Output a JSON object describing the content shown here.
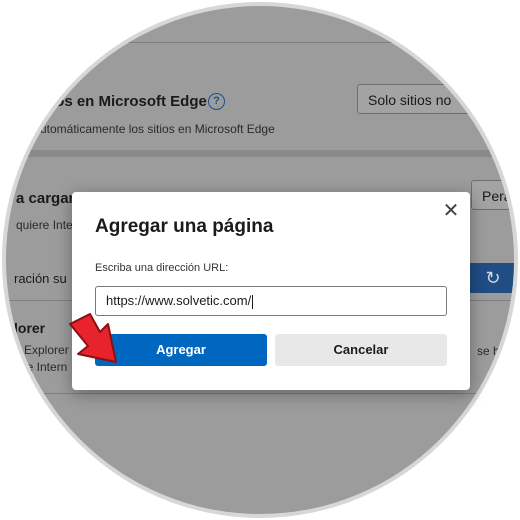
{
  "background": {
    "section1_title": "tios en Microsoft Edge",
    "section1_subtitle": "utomáticamente los sitios en Microsoft Edge",
    "help_icon_glyph": "?",
    "dropdown_label": "Solo sitios no",
    "section2_title": "a cargar",
    "section2_subtitle": "quiere Inter",
    "section2_button_label": "Pera",
    "section3_label": "ración su",
    "section4_title": "lorer",
    "section4_line1": "Explorer",
    "section4_line2": "le Intern",
    "section4_right_text": "se ha"
  },
  "dialog": {
    "title": "Agregar una página",
    "close_glyph": "✕",
    "url_label": "Escriba una dirección URL:",
    "url_value": "https://www.solvetic.com/",
    "add_label": "Agregar",
    "cancel_label": "Cancelar"
  },
  "colors": {
    "primary": "#0067c0",
    "annotation_arrow": "#e8232b"
  }
}
